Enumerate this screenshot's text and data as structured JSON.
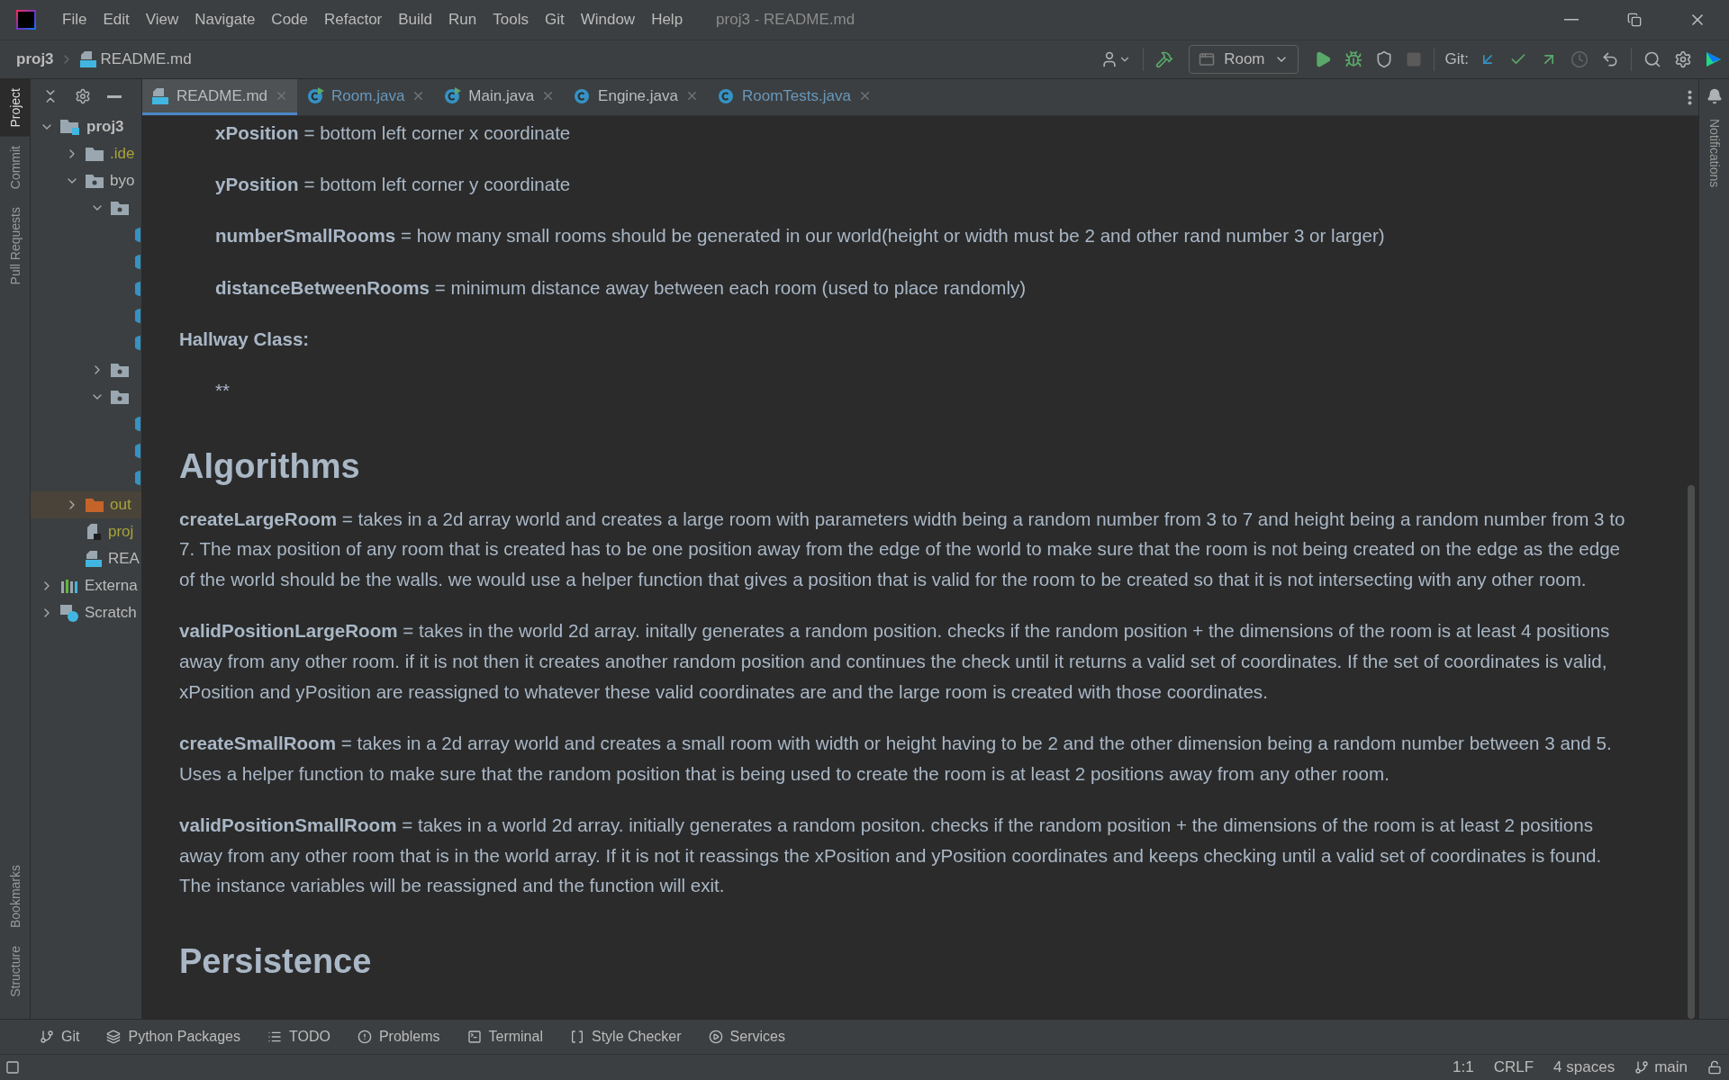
{
  "window": {
    "title": "proj3 - README.md"
  },
  "menu": [
    "File",
    "Edit",
    "View",
    "Navigate",
    "Code",
    "Refactor",
    "Build",
    "Run",
    "Tools",
    "Git",
    "Window",
    "Help"
  ],
  "breadcrumb": [
    "proj3",
    "README.md"
  ],
  "toolbar": {
    "run_config": "Room",
    "git_label": "Git:"
  },
  "left_strip": [
    {
      "label": "Project",
      "selected": true
    },
    {
      "label": "Commit",
      "selected": false
    },
    {
      "label": "Pull Requests",
      "selected": false
    }
  ],
  "left_strip_bottom": [
    {
      "label": "Bookmarks",
      "selected": false
    },
    {
      "label": "Structure",
      "selected": false
    }
  ],
  "tree": [
    {
      "kind": "module",
      "label": "proj3",
      "expanded": true,
      "children": [
        {
          "kind": "folder",
          "label": ".ide",
          "expanded": false,
          "ignored": true
        },
        {
          "kind": "package",
          "label": "byo",
          "expanded": true,
          "children": [
            {
              "kind": "package",
              "expanded": true,
              "children": [
                {
                  "kind": "class"
                },
                {
                  "kind": "class"
                },
                {
                  "kind": "class"
                },
                {
                  "kind": "class"
                },
                {
                  "kind": "class"
                }
              ]
            },
            {
              "kind": "package",
              "expanded": false
            },
            {
              "kind": "package",
              "expanded": true,
              "children": [
                {
                  "kind": "class"
                },
                {
                  "kind": "class"
                },
                {
                  "kind": "class"
                }
              ]
            }
          ]
        },
        {
          "kind": "excluded",
          "label": "out",
          "expanded": false,
          "ignored": true,
          "highlighted": true
        },
        {
          "kind": "iml",
          "label": "proj",
          "ignored": true
        },
        {
          "kind": "markdown",
          "label": "REA"
        }
      ]
    },
    {
      "kind": "libraries",
      "label": "Externa",
      "expanded": false
    },
    {
      "kind": "scratches",
      "label": "Scratch",
      "expanded": false
    }
  ],
  "tabs": [
    {
      "label": "README.md",
      "kind": "markdown",
      "selected": true,
      "modified": false
    },
    {
      "label": "Room.java",
      "kind": "runnable",
      "selected": false,
      "modified": true
    },
    {
      "label": "Main.java",
      "kind": "runnable",
      "selected": false,
      "modified": false
    },
    {
      "label": "Engine.java",
      "kind": "class",
      "selected": false,
      "modified": false
    },
    {
      "label": "RoomTests.java",
      "kind": "class",
      "selected": false,
      "modified": true
    }
  ],
  "document": [
    {
      "kind": "item",
      "text": "**xPosition** = bottom left corner x coordinate"
    },
    {
      "kind": "item",
      "text": "**yPosition** = bottom left corner y coordinate"
    },
    {
      "kind": "item",
      "text": "**numberSmallRooms** = how many small rooms should be generated in our world(height or width must be 2 and other rand number 3 or larger)"
    },
    {
      "kind": "item",
      "text": "**distanceBetweenRooms** = minimum distance away between each room (used to place randomly)"
    },
    {
      "kind": "label",
      "text": "Hallway Class:"
    },
    {
      "kind": "item",
      "text": "**"
    },
    {
      "kind": "heading",
      "text": "Algorithms"
    },
    {
      "kind": "paragraph",
      "text": "**createLargeRoom** = takes in a 2d array world and creates a large room with parameters width being a random number from 3 to 7 and height being a random number from 3 to 7. The max position of any room that is created has to be one position away from the edge of the world to make sure that the room is not being created on the edge as the edge of the world should be the walls. we would use a helper function that gives a position that is valid for the room to be created so that it is not intersecting with any other room."
    },
    {
      "kind": "paragraph",
      "text": "**validPositionLargeRoom** = takes in the world 2d array. initally generates a random position. checks if the random position + the dimensions of the room is at least 4 positions away from any other room. if it is not then it creates another random position and continues the check until it returns a valid set of coordinates. If the set of coordinates is valid, xPosition and yPosition are reassigned to whatever these valid coordinates are and the large room is created with those coordinates."
    },
    {
      "kind": "paragraph",
      "text": "**createSmallRoom** = takes in a 2d array world and creates a small room with width or height having to be 2 and the other dimension being a random number between 3 and 5. Uses a helper function to make sure that the random position that is being used to create the room is at least 2 positions away from any other room."
    },
    {
      "kind": "paragraph",
      "text": "**validPositionSmallRoom** = takes in a world 2d array. initially generates a random positon. checks if the random position + the dimensions of the room is at least 2 positions away from any other room that is in the world array. If it is not it reassings the xPosition and yPosition coordinates and keeps checking until a valid set of coordinates is found. The instance variables will be reassigned and the function will exit."
    },
    {
      "kind": "heading",
      "text": "Persistence"
    }
  ],
  "right_strip": [
    {
      "label": "Notifications"
    }
  ],
  "bottom_tools": [
    {
      "kind": "git",
      "label": "Git"
    },
    {
      "kind": "packages",
      "label": "Python Packages"
    },
    {
      "kind": "todo",
      "label": "TODO"
    },
    {
      "kind": "problems",
      "label": "Problems"
    },
    {
      "kind": "terminal",
      "label": "Terminal"
    },
    {
      "kind": "checker",
      "label": "Style Checker"
    },
    {
      "kind": "services",
      "label": "Services"
    }
  ],
  "status_bar": {
    "position": "1:1",
    "line_separator": "CRLF",
    "indent": "4 spaces",
    "branch": "main"
  }
}
